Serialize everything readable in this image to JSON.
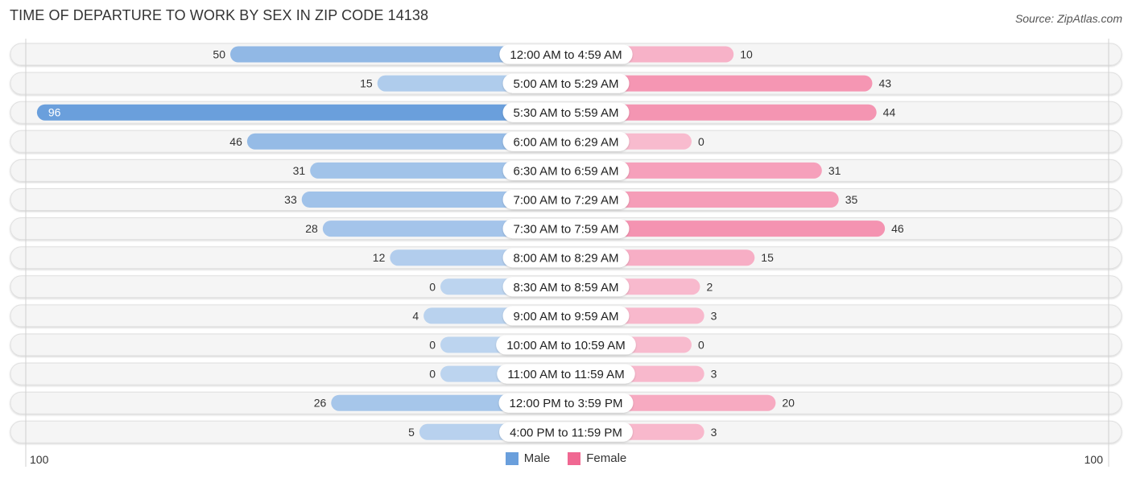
{
  "chart_data": {
    "type": "bar",
    "orientation": "horizontal-diverging",
    "title": "TIME OF DEPARTURE TO WORK BY SEX IN ZIP CODE 14138",
    "source": "Source: ZipAtlas.com",
    "categories": [
      "12:00 AM to 4:59 AM",
      "5:00 AM to 5:29 AM",
      "5:30 AM to 5:59 AM",
      "6:00 AM to 6:29 AM",
      "6:30 AM to 6:59 AM",
      "7:00 AM to 7:29 AM",
      "7:30 AM to 7:59 AM",
      "8:00 AM to 8:29 AM",
      "8:30 AM to 8:59 AM",
      "9:00 AM to 9:59 AM",
      "10:00 AM to 10:59 AM",
      "11:00 AM to 11:59 AM",
      "12:00 PM to 3:59 PM",
      "4:00 PM to 11:59 PM"
    ],
    "series": [
      {
        "name": "Male",
        "color": "#6a9fdc",
        "values": [
          50,
          15,
          96,
          46,
          31,
          33,
          28,
          12,
          0,
          4,
          0,
          0,
          26,
          5
        ]
      },
      {
        "name": "Female",
        "color": "#f06892",
        "values": [
          10,
          43,
          44,
          0,
          31,
          35,
          46,
          15,
          2,
          3,
          0,
          3,
          20,
          3
        ]
      }
    ],
    "xlim": [
      -100,
      100
    ],
    "axis_labels": {
      "left": "100",
      "right": "100"
    },
    "legend": {
      "placement": "bottom-center",
      "items": [
        "Male",
        "Female"
      ]
    }
  }
}
